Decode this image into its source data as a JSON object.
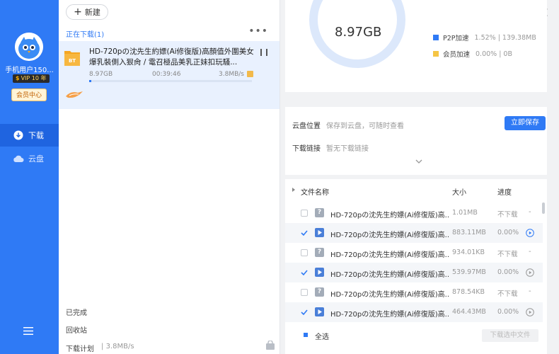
{
  "app": {
    "new_label": "新建",
    "window_controls": [
      "minimize",
      "maximize",
      "close"
    ]
  },
  "sidebar": {
    "username": "手机用户150...",
    "vip_text": "VIP 10 年",
    "vip_center_label": "会员中心",
    "nav": [
      {
        "label": "下载",
        "icon": "download-icon"
      },
      {
        "label": "云盘",
        "icon": "cloud-icon"
      }
    ],
    "menu_icon": "hamburger-menu-icon",
    "accent_color": "#2f7af5"
  },
  "tasks": {
    "section_title": "正在下载(1)",
    "items": [
      {
        "title": "HD-720pの沈先生約嫖(Ai修復版)高顏值外圍美女爆乳裝側入狠肏 / 電召極品美乳正妹扣玩騷...",
        "file_type": "BT",
        "downloaded": "8.97GB",
        "elapsed": "00:39:46",
        "speed": "3.8MB/s",
        "progress": 0.015
      }
    ],
    "completed_label": "已完成",
    "recycle_label": "回收站",
    "plan_label": "下载计划",
    "plan_speed": "3.8MB/s"
  },
  "stats": {
    "total": "8.97GB",
    "legend": [
      {
        "label": "P2P加速",
        "percent": "1.52%",
        "value": "139.38MB",
        "color": "#2f7af5"
      },
      {
        "label": "会员加速",
        "percent": "0.00%",
        "value": "0B",
        "color": "#f5c545"
      }
    ]
  },
  "cloud": {
    "location_label": "云盘位置",
    "location_value": "保存到云盘，可随时查看",
    "link_label": "下载链接",
    "link_value": "暂无下载链接",
    "save_button": "立即保存"
  },
  "files": {
    "headers": {
      "name": "文件名称",
      "size": "大小",
      "progress": "进度"
    },
    "rows": [
      {
        "checked": false,
        "type": "unknown",
        "name": "HD-720pの沈先生約嫖(Ai修復版)高...",
        "size": "1.01MB",
        "progress": "不下载",
        "action": "-"
      },
      {
        "checked": true,
        "type": "video",
        "name": "HD-720pの沈先生約嫖(Ai修復版)高...",
        "size": "883.11MB",
        "progress": "0.00%",
        "action": "play"
      },
      {
        "checked": false,
        "type": "unknown",
        "name": "HD-720pの沈先生約嫖(Ai修復版)高...",
        "size": "934.01KB",
        "progress": "不下载",
        "action": "-"
      },
      {
        "checked": true,
        "type": "video",
        "name": "HD-720pの沈先生約嫖(Ai修復版)高...",
        "size": "539.97MB",
        "progress": "0.00%",
        "action": "play"
      },
      {
        "checked": false,
        "type": "unknown",
        "name": "HD-720pの沈先生約嫖(Ai修復版)高...",
        "size": "878.54KB",
        "progress": "不下载",
        "action": "-"
      },
      {
        "checked": true,
        "type": "video",
        "name": "HD-720pの沈先生約嫖(Ai修復版)高...",
        "size": "464.43MB",
        "progress": "0.00%",
        "action": "play"
      }
    ],
    "select_all_label": "全选",
    "download_selected_label": "下载选中文件"
  }
}
